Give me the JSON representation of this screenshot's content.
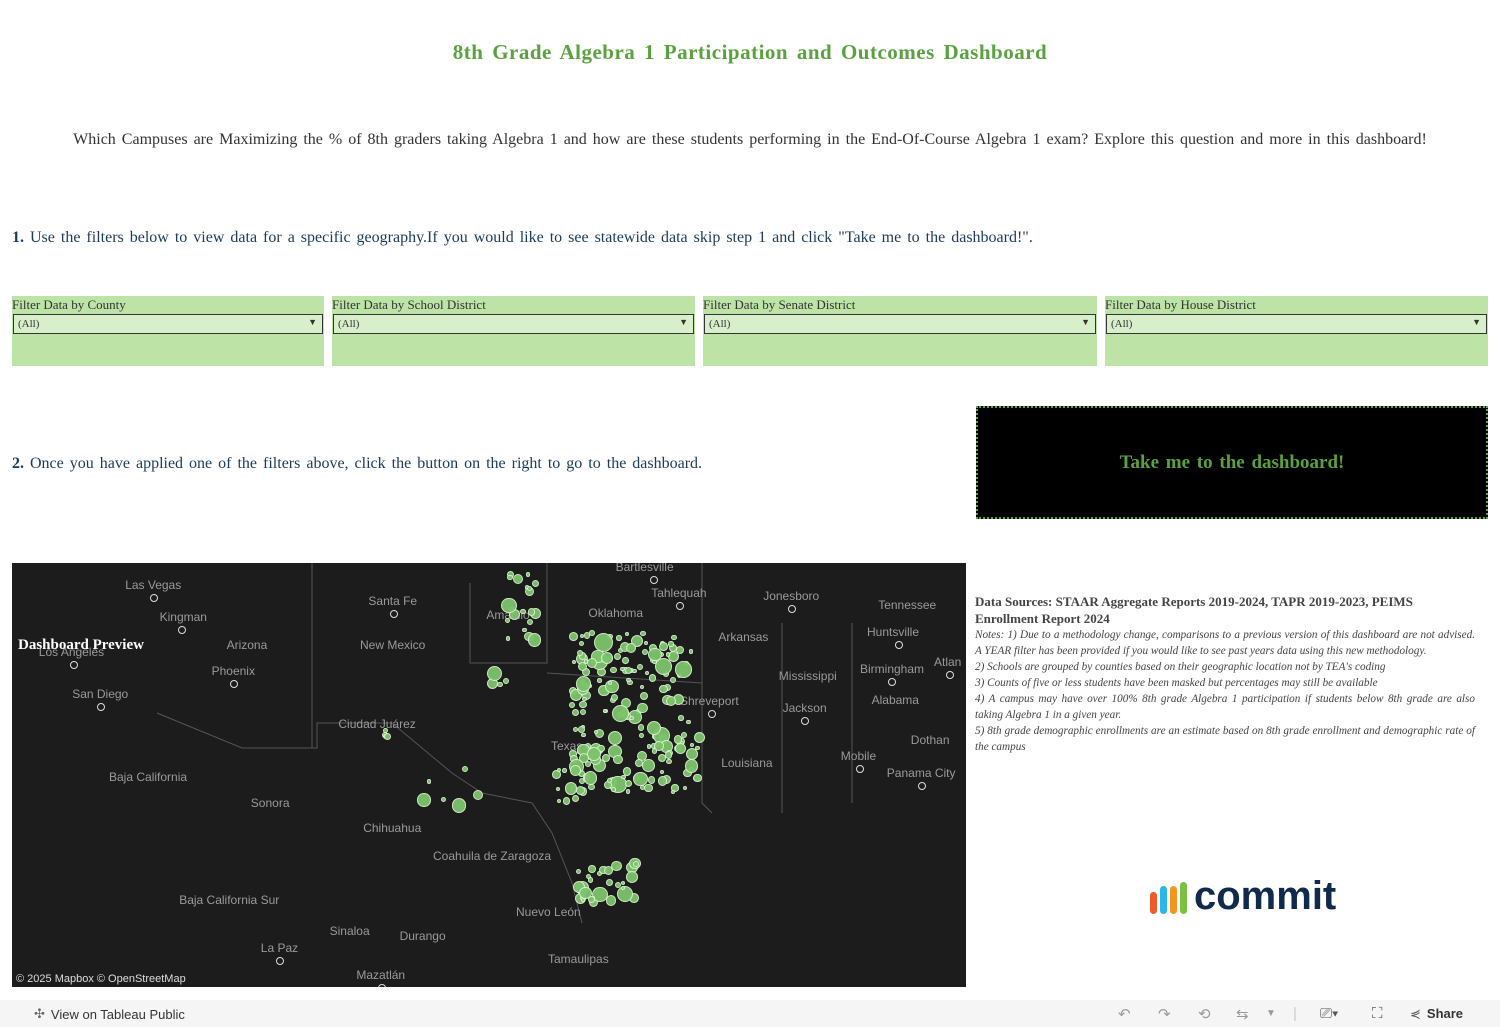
{
  "title": "8th Grade Algebra 1 Participation and Outcomes Dashboard",
  "subtitle": "Which Campuses are Maximizing the % of 8th graders taking Algebra 1 and how are these students performing in the End-Of-Course Algebra 1 exam? Explore this question and more in this dashboard!",
  "step1": {
    "num": "1.",
    "text": "Use the filters below to view data for a specific geography.If you would like to see statewide data skip step 1 and click \"Take me to the dashboard!\"."
  },
  "filters": [
    {
      "label": "Filter Data by County",
      "value": "(All)"
    },
    {
      "label": "Filter Data by School District",
      "value": "(All)"
    },
    {
      "label": "Filter Data by Senate District",
      "value": "(All)"
    },
    {
      "label": "Filter Data by House District",
      "value": "(All)"
    }
  ],
  "step2": {
    "num": "2.",
    "text": "Once you have applied one of the filters above, click the button on the right to go to the dashboard."
  },
  "cta_label": "Take me to the dashboard!",
  "map": {
    "preview_label": "Dashboard Preview",
    "attribution": "© 2025 Mapbox  © OpenStreetMap",
    "labels": [
      "Las Vegas",
      "Kingman",
      "Los Angeles",
      "San Diego",
      "Arizona",
      "Phoenix",
      "Santa Fe",
      "New Mexico",
      "Ciudad Juárez",
      "Baja California",
      "Sonora",
      "Chihuahua",
      "Baja California Sur",
      "La Paz",
      "Sinaloa",
      "Durango",
      "Mazatlán",
      "Coahuila de Zaragoza",
      "Nuevo León",
      "Tamaulipas",
      "Texas",
      "Oklahoma",
      "Bartlesville",
      "Tahlequah",
      "Jonesboro",
      "Arkansas",
      "Tennessee",
      "Huntsville",
      "Birmingham",
      "Mississippi",
      "Alabama",
      "Atlan",
      "Jackson",
      "Shreveport",
      "Louisiana",
      "Mobile",
      "Dothan",
      "Panama City",
      "Amarillo"
    ]
  },
  "notes": {
    "sources": "Data Sources: STAAR Aggregate Reports 2019-2024, TAPR 2019-2023, PEIMS Enrollment Report 2024",
    "items": [
      "Notes: 1) Due to a methodology change, comparisons to a previous version of this dashboard are not advised. A YEAR filter has been provided if you would like to see past years data using this new methodology.",
      "2) Schools are grouped by counties based on their geographic location not by TEA's coding",
      "3) Counts of five or less students have been masked but percentages may still be available",
      "4) A campus may have over 100% 8th grade Algebra 1 participation if students below 8th grade are also taking Algebra 1 in a given year.",
      "5) 8th grade demographic enrollments are an estimate based on 8th grade enrollment and demographic rate of the campus"
    ]
  },
  "logo_text": "commit",
  "footer": {
    "view_label": "View on Tableau Public",
    "share_label": "Share"
  },
  "colors": {
    "accent": "#5aa13f",
    "filter_bg": "#bde3a6",
    "map_bg": "#1c1c1c",
    "dot": "#7cc46a"
  }
}
